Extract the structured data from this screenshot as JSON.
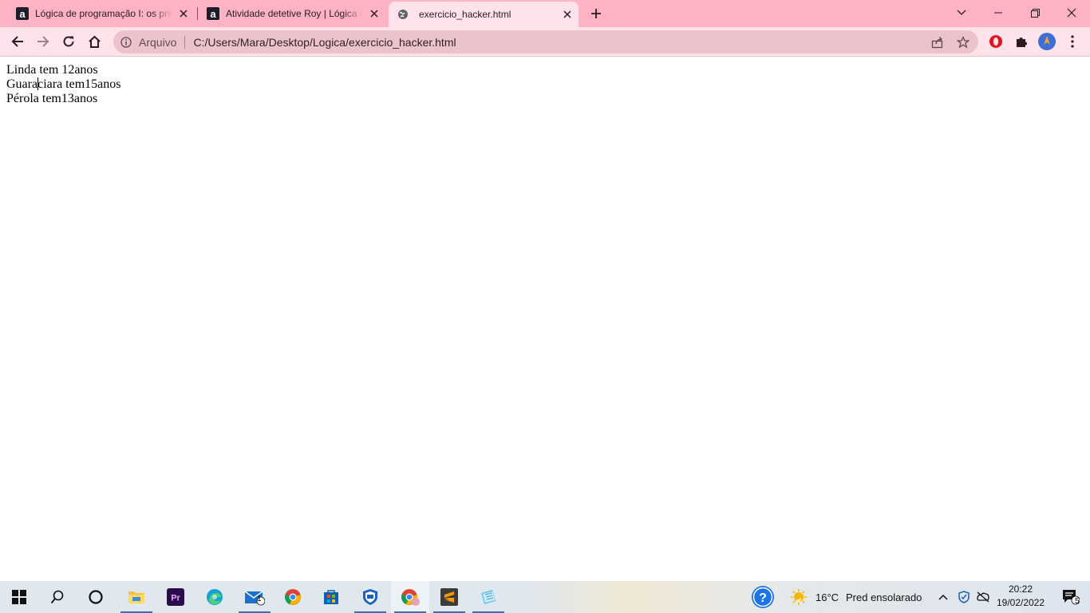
{
  "browser": {
    "tabs": [
      {
        "label": "Lógica de programação I: os prin",
        "favicon": "alura-a-icon",
        "active": false
      },
      {
        "label": "Atividade detetive Roy | Lógica d",
        "favicon": "alura-a-icon",
        "active": false
      },
      {
        "label": "exercicio_hacker.html",
        "favicon": "globe-icon",
        "active": true
      }
    ],
    "omnibox": {
      "scheme_label": "Arquivo",
      "url": "C:/Users/Mara/Desktop/Logica/exercicio_hacker.html"
    },
    "colors": {
      "tabstrip": "#fdb3c4",
      "toolbar": "#ffe3ea",
      "omnibox": "#ecc3cd"
    }
  },
  "page": {
    "lines": [
      {
        "before_caret": "Linda tem 12anos",
        "after_caret": ""
      },
      {
        "before_caret": "Guara",
        "after_caret": "ciara tem15anos"
      },
      {
        "before_caret": "Pérola tem13anos",
        "after_caret": ""
      }
    ]
  },
  "taskbar": {
    "apps": [
      "windows-start-icon",
      "search-icon",
      "cortana-icon",
      "file-explorer-icon",
      "premiere-icon",
      "edge-icon",
      "mail-icon",
      "chrome-icon",
      "microsoft-store-icon",
      "defender-icon",
      "chrome-profile-icon",
      "sublime-text-icon",
      "notepad-icon"
    ],
    "mail_badge": "1",
    "notifications_badge": "5",
    "weather": {
      "temperature": "16°C",
      "condition": "Pred ensolarado"
    },
    "clock": {
      "time": "20:22",
      "date": "19/02/2022"
    }
  }
}
